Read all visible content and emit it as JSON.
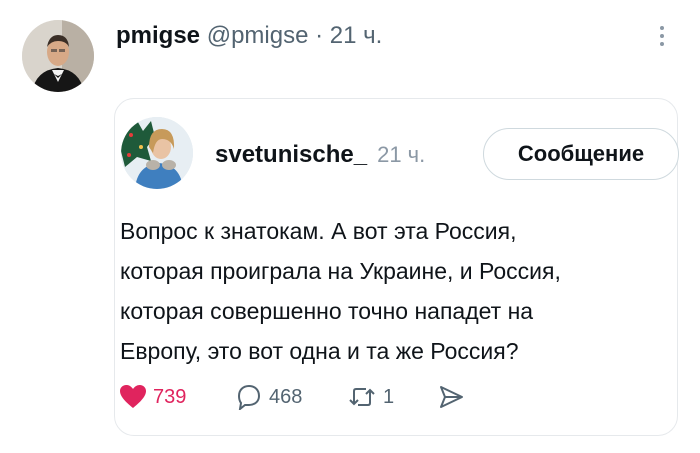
{
  "outer_tweet": {
    "name": "pmigse",
    "handle": "@pmigse",
    "separator": "·",
    "time": "21 ч.",
    "avatar_icon": "user-avatar-man-in-suit",
    "more_icon": "more-vertical-icon"
  },
  "quoted_tweet": {
    "name": "svetunische_",
    "time": "21 ч.",
    "avatar_icon": "user-avatar-woman-with-christmas-tree",
    "message_button": "Сообщение",
    "text": "Вопрос к знатокам. А вот эта Россия,\nкоторая проиграла на Украине, и Россия,\nкоторая совершенно точно нападет на\nЕвропу, это вот одна и та же Россия?",
    "actions": {
      "likes": "739",
      "replies": "468",
      "reposts": "1",
      "like_icon": "heart-filled-icon",
      "reply_icon": "reply-bubble-icon",
      "repost_icon": "repost-icon",
      "share_icon": "share-send-icon"
    }
  },
  "colors": {
    "like_red": "#e0245e",
    "secondary_text": "#536471",
    "border": "#e6e9ec"
  }
}
